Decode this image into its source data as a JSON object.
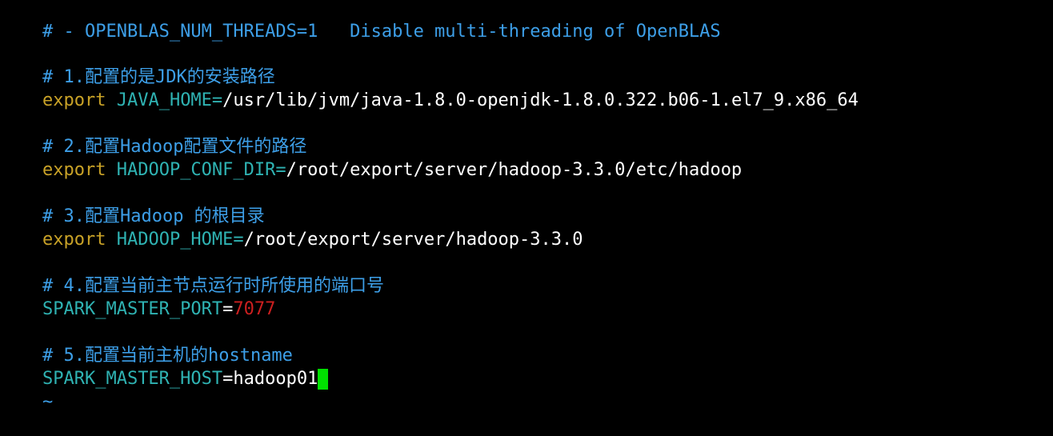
{
  "colors": {
    "background": "#000000",
    "comment": "#3d9fe8",
    "keyword": "#c9a227",
    "identifier": "#2fb3b3",
    "value": "#ffffff",
    "number": "#cc1f1f",
    "cursor": "#00e000"
  },
  "lines": {
    "top_comment": "# - OPENBLAS_NUM_THREADS=1   Disable multi-threading of OpenBLAS",
    "c1": "# 1.配置的是JDK的安装路径",
    "e1_kw": "export",
    "e1_var": "JAVA_HOME=",
    "e1_val": "/usr/lib/jvm/java-1.8.0-openjdk-1.8.0.322.b06-1.el7_9.x86_64",
    "c2": "# 2.配置Hadoop配置文件的路径",
    "e2_kw": "export",
    "e2_var": "HADOOP_CONF_DIR=",
    "e2_val": "/root/export/server/hadoop-3.3.0/etc/hadoop",
    "c3": "# 3.配置Hadoop 的根目录",
    "e3_kw": "export",
    "e3_var": "HADOOP_HOME=",
    "e3_val": "/root/export/server/hadoop-3.3.0",
    "c4": "# 4.配置当前主节点运行时所使用的端口号",
    "e4_var": "SPARK_MASTER_PORT",
    "e4_eq": "=",
    "e4_val": "7077",
    "c5": "# 5.配置当前主机的hostname",
    "e5_var": "SPARK_MASTER_HOST",
    "e5_eq": "=",
    "e5_val": "hadoop01",
    "tilde": "~"
  }
}
